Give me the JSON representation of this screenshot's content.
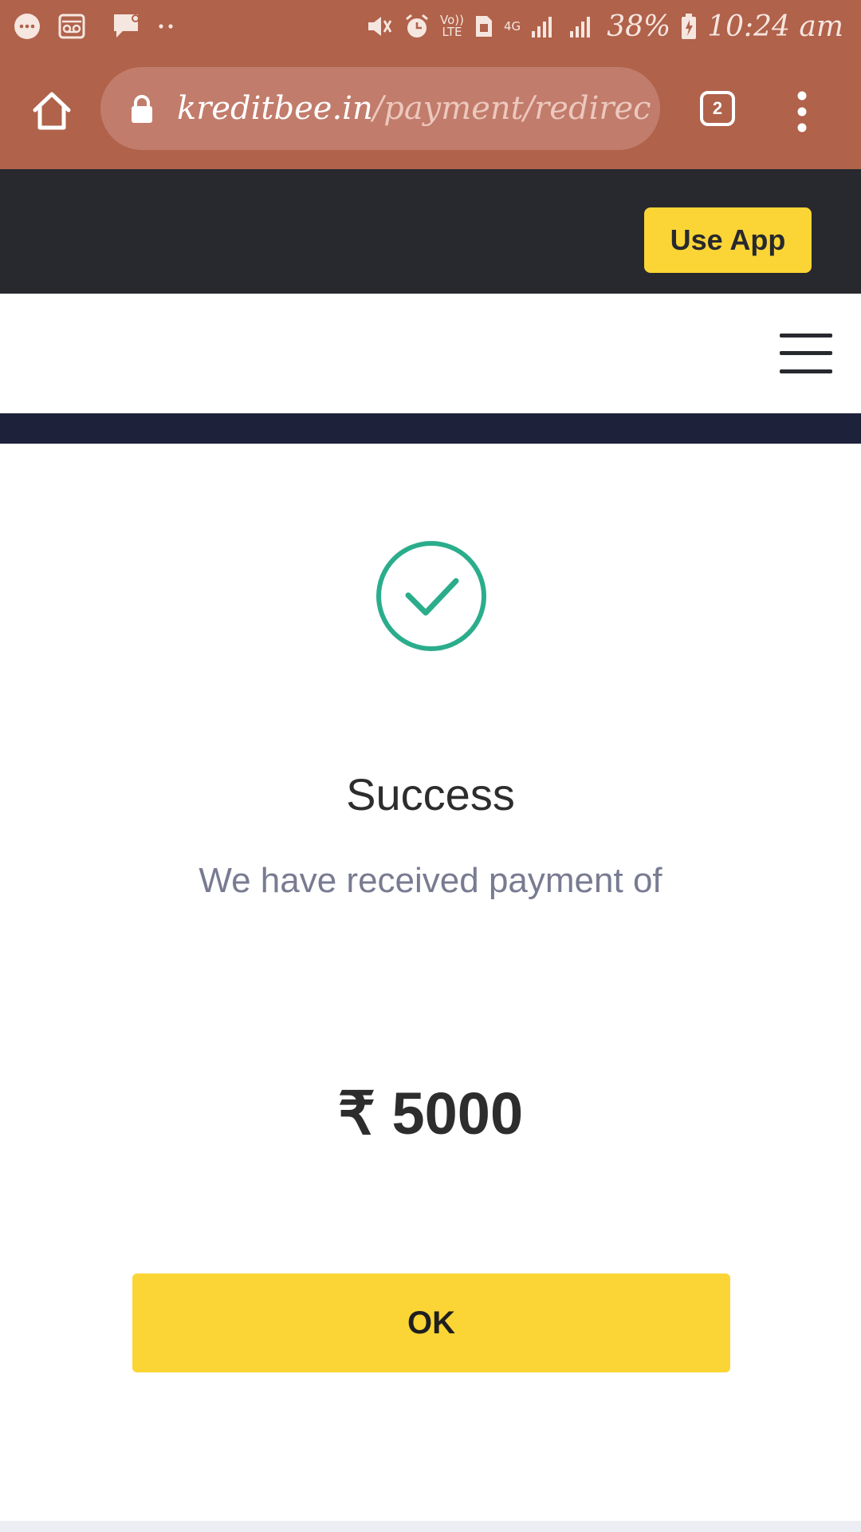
{
  "status_bar": {
    "network_small": "Vo))\nLTE",
    "network_4g": "4G",
    "battery_percent": "38%",
    "time": "10:24 am"
  },
  "browser": {
    "url_host": "kreditbee.in",
    "url_path": "/payment/redirec",
    "tab_count": "2"
  },
  "header": {
    "use_app_label": "Use App"
  },
  "result": {
    "title": "Success",
    "message": "We have received payment of",
    "amount": "₹ 5000",
    "ok_label": "OK"
  },
  "colors": {
    "chrome": "#b0624a",
    "header_dark": "#27292e",
    "accent_yellow": "#fbd535",
    "success_green": "#2bad8c",
    "navy": "#1d2139"
  }
}
